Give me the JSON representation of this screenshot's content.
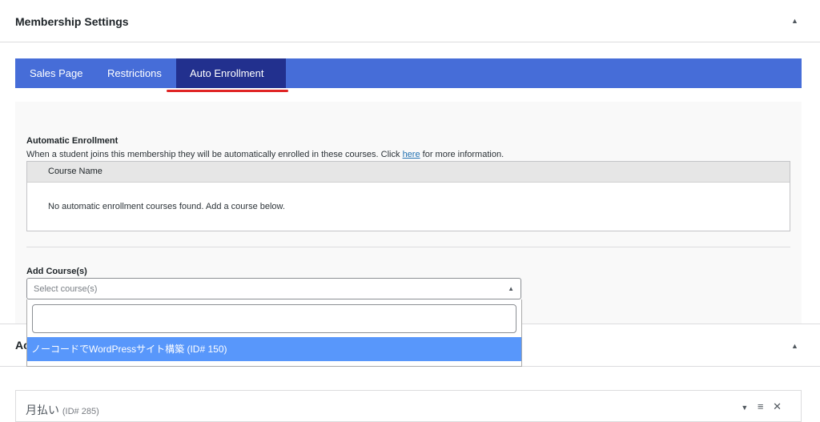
{
  "header": {
    "title": "Membership Settings",
    "collapse_icon": "▲"
  },
  "tabs": [
    {
      "label": "Sales Page",
      "active": false
    },
    {
      "label": "Restrictions",
      "active": false
    },
    {
      "label": "Auto Enrollment",
      "active": true
    }
  ],
  "auto_enrollment": {
    "title": "Automatic Enrollment",
    "description_before": "When a student joins this membership they will be automatically enrolled in these courses. Click ",
    "link_text": "here",
    "description_after": " for more information.",
    "table": {
      "column_header": "Course Name",
      "empty_message": "No automatic enrollment courses found. Add a course below."
    }
  },
  "add_courses": {
    "label": "Add Course(s)",
    "placeholder": "Select course(s)",
    "search_value": "",
    "options": [
      {
        "label": "ノーコードでWordPressサイト構築 (ID# 150)",
        "highlighted": true
      }
    ]
  },
  "section2": {
    "title_visible": "Ac",
    "collapse_icon": "▲"
  },
  "plan_row": {
    "name": "月払い",
    "id_label": "(ID# 285)",
    "actions": [
      "▼",
      "≡",
      "✕"
    ]
  },
  "colors": {
    "tab_bar": "#466dd8",
    "tab_active": "#22308e",
    "tab_underline": "#e02424",
    "option_highlight": "#5897fb",
    "link": "#2271b1"
  }
}
